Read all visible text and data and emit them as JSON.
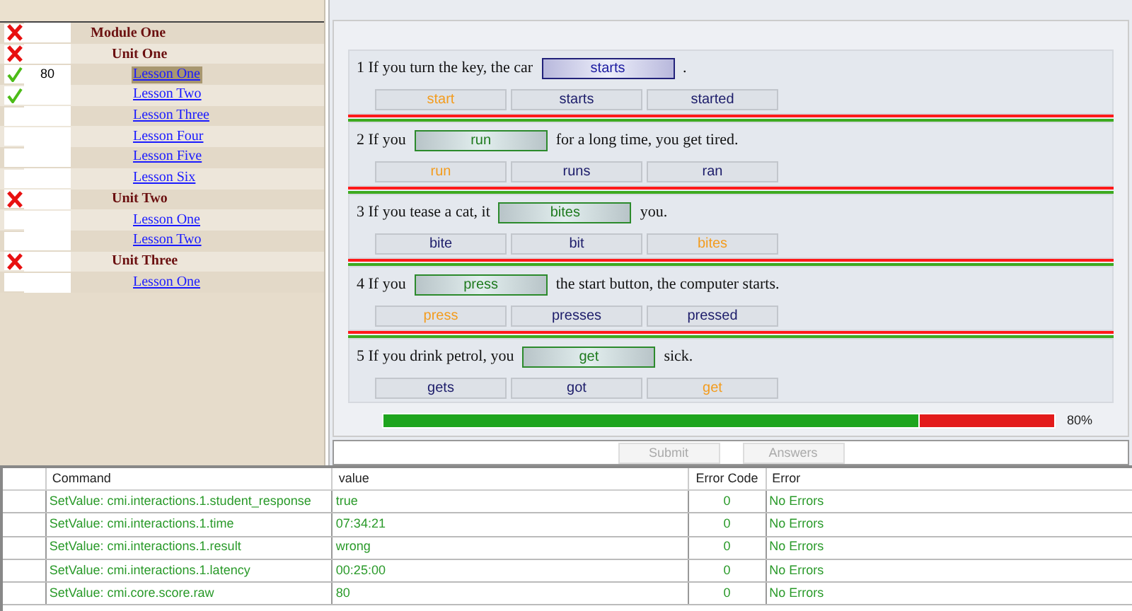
{
  "tree": [
    {
      "label": "Module One",
      "failed": true,
      "passed": false,
      "selected": false,
      "children": [
        {
          "label": "Unit One",
          "failed": true,
          "passed": false,
          "selected": false,
          "children": [
            {
              "label": "Lesson One",
              "failed": false,
              "passed": true,
              "score": "80",
              "selected": true
            },
            {
              "label": "Lesson Two",
              "failed": false,
              "passed": true,
              "selected": false
            },
            {
              "label": "Lesson Three",
              "failed": false,
              "passed": false,
              "selected": false
            },
            {
              "label": "Lesson Four",
              "failed": false,
              "passed": false,
              "selected": false
            },
            {
              "label": "Lesson Five",
              "failed": false,
              "passed": false,
              "selected": false
            },
            {
              "label": "Lesson Six",
              "failed": false,
              "passed": false,
              "selected": false
            }
          ]
        },
        {
          "label": "Unit Two",
          "failed": true,
          "passed": false,
          "selected": false,
          "children": [
            {
              "label": "Lesson One",
              "failed": false,
              "passed": false,
              "selected": false
            },
            {
              "label": "Lesson Two",
              "failed": false,
              "passed": false,
              "selected": false
            }
          ]
        },
        {
          "label": "Unit Three",
          "failed": true,
          "passed": false,
          "selected": false,
          "children": [
            {
              "label": "Lesson One",
              "failed": false,
              "passed": false,
              "selected": false
            }
          ]
        }
      ]
    }
  ],
  "questions": [
    {
      "number": "1",
      "before": "If you turn the key, the car",
      "answer": "starts",
      "correct": false,
      "after": ".",
      "options": [
        {
          "label": "start",
          "selected": true
        },
        {
          "label": "starts",
          "selected": false
        },
        {
          "label": "started",
          "selected": false
        }
      ]
    },
    {
      "number": "2",
      "before": "If you",
      "answer": "run",
      "correct": true,
      "after": "for a long time, you get tired.",
      "options": [
        {
          "label": "run",
          "selected": true
        },
        {
          "label": "runs",
          "selected": false
        },
        {
          "label": "ran",
          "selected": false
        }
      ]
    },
    {
      "number": "3",
      "before": "If you tease a cat, it",
      "answer": "bites",
      "correct": true,
      "after": "you.",
      "options": [
        {
          "label": "bite",
          "selected": false
        },
        {
          "label": "bit",
          "selected": false
        },
        {
          "label": "bites",
          "selected": true
        }
      ]
    },
    {
      "number": "4",
      "before": "If you",
      "answer": "press",
      "correct": true,
      "after": "the start button, the computer starts.",
      "options": [
        {
          "label": "press",
          "selected": true
        },
        {
          "label": "presses",
          "selected": false
        },
        {
          "label": "pressed",
          "selected": false
        }
      ]
    },
    {
      "number": "5",
      "before": "If you drink petrol, you",
      "answer": "get",
      "correct": true,
      "after": "sick.",
      "options": [
        {
          "label": "gets",
          "selected": false
        },
        {
          "label": "got",
          "selected": false
        },
        {
          "label": "get",
          "selected": true
        }
      ]
    }
  ],
  "score_bar": {
    "level": 0.8,
    "reading": "80%"
  },
  "buttons": [
    {
      "label": "Submit",
      "disabled": true
    },
    {
      "label": "Answers",
      "disabled": true
    }
  ],
  "log_table": {
    "columns": [
      "Command",
      "value",
      "Error Code",
      "Error"
    ],
    "rows": [
      [
        "SetValue: cmi.interactions.1.student_response",
        "true",
        "0",
        "No Errors"
      ],
      [
        "SetValue: cmi.interactions.1.time",
        "07:34:21",
        "0",
        "No Errors"
      ],
      [
        "SetValue: cmi.interactions.1.result",
        "wrong",
        "0",
        "No Errors"
      ],
      [
        "SetValue: cmi.interactions.1.latency",
        "00:25:00",
        "0",
        "No Errors"
      ],
      [
        "SetValue: cmi.core.score.raw",
        "80",
        "0",
        "No Errors"
      ]
    ]
  }
}
